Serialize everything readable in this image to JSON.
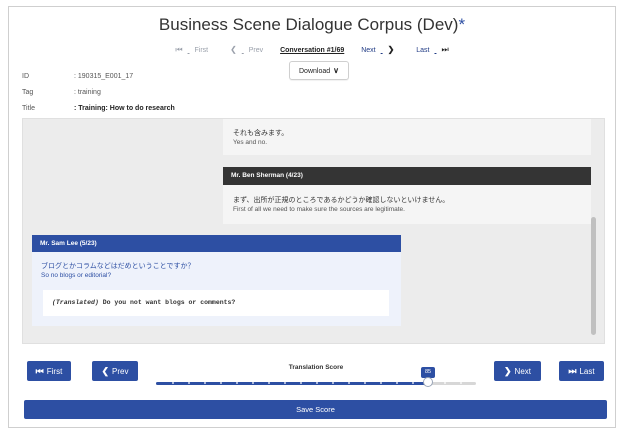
{
  "header": {
    "title": "Business Scene Dialogue Corpus (Dev)",
    "title_marker": "*",
    "nav": {
      "first_label": "First",
      "prev_label": "Prev",
      "current_label": "Conversation #1/69",
      "next_label": "Next",
      "last_label": "Last"
    },
    "download_label": "Download"
  },
  "meta": [
    {
      "key": "ID",
      "value": ": 190315_E001_17"
    },
    {
      "key": "Tag",
      "value": ": training"
    },
    {
      "key": "Title",
      "value": ": Training: How to do research"
    }
  ],
  "chat": {
    "msg_prev": {
      "japanese": "それも含みます。",
      "english": "Yes and no."
    },
    "msg_ben": {
      "speaker": "Mr. Ben Sherman (4/23)",
      "japanese": "まず、出所が正規のところであるかどうか確認しないといけません。",
      "english": "First of all we need to make sure the sources are legitimate."
    },
    "msg_sam": {
      "speaker": "Mr. Sam Lee (5/23)",
      "japanese": "ブログとかコラムなどはだめということですか？",
      "english": "So no blogs or editorial?",
      "translated_tag": "(Translated)",
      "translated_text": " Do you not want blogs or comments?"
    }
  },
  "controls": {
    "first_label": "First",
    "prev_label": "Prev",
    "next_label": "Next",
    "last_label": "Last",
    "score_label": "Translation Score",
    "score_value": "85",
    "score_fraction": 0.85,
    "save_label": "Save Score"
  },
  "colors": {
    "accent": "#2d4fa3",
    "dark_header": "#343434"
  }
}
